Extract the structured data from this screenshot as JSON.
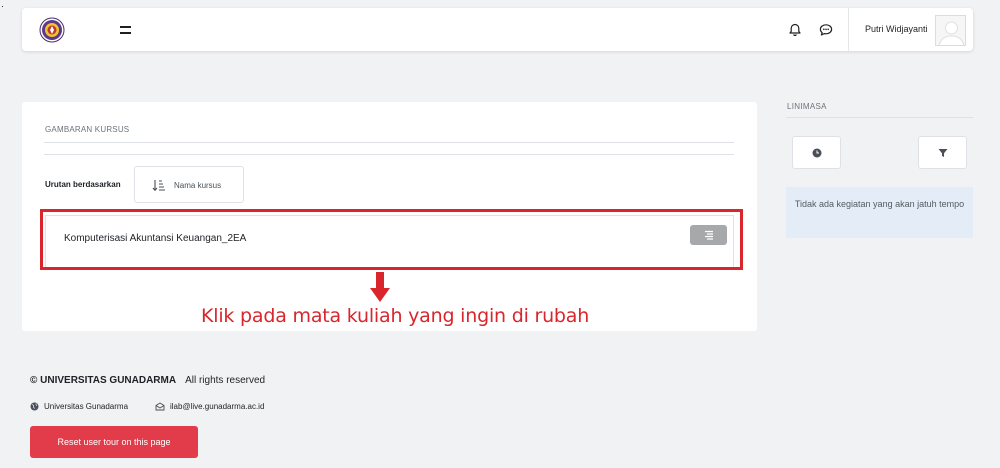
{
  "header": {
    "logo_icon": "university-seal-icon",
    "menu_icon": "hamburger-menu-icon",
    "notifications_icon": "bell-icon",
    "messages_icon": "chat-bubble-icon",
    "user_name": "Putri Widjayanti",
    "avatar_icon": "default-user-avatar"
  },
  "course_overview": {
    "title": "GAMBARAN KURSUS",
    "sort_label": "Urutan berdasarkan",
    "sort_button": {
      "icon": "sort-ascending-icon",
      "label": "Nama kursus"
    },
    "courses": [
      {
        "name": "Komputerisasi Akuntansi Keuangan_2EA",
        "menu_icon": "list-menu-icon"
      }
    ]
  },
  "annotation": {
    "text": "Klik pada mata kuliah yang ingin di rubah",
    "color": "#d9262c"
  },
  "timeline": {
    "title": "LINIMASA",
    "date_filter_icon": "clock-icon",
    "sort_filter_icon": "funnel-icon",
    "empty_message": "Tidak ada kegiatan yang akan jatuh tempo"
  },
  "footer": {
    "copyright": "© UNIVERSITAS GUNADARMA",
    "rights": "All rights reserved",
    "website_label": "Universitas Gunadarma",
    "email": "ilab@live.gunadarma.ac.id",
    "reset_button": "Reset user tour on this page"
  },
  "colors": {
    "accent": "#e23b49",
    "annotation": "#d9262c",
    "page_background": "#f1f2f4",
    "timeline_empty_background": "#e3ecf7"
  }
}
